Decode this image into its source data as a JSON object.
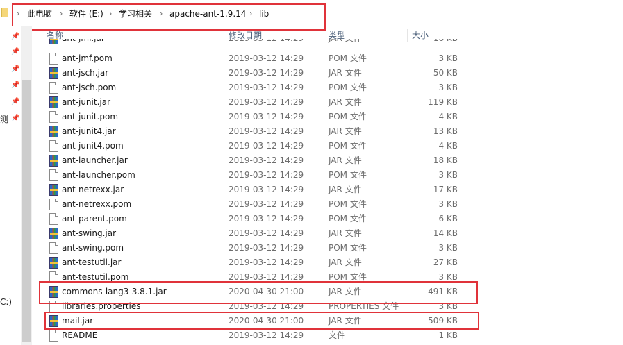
{
  "breadcrumb": [
    "此电脑",
    "软件 (E:)",
    "学习相关",
    "apache-ant-1.9.14",
    "lib"
  ],
  "sidebar": {
    "cut_label_1": "测",
    "cut_label_2": "C:)"
  },
  "columns": {
    "name": "名称",
    "date": "修改日期",
    "type": "类型",
    "size": "大小"
  },
  "partial_row": {
    "name": "ant-jmf.jar",
    "date": "2019-03-12 14:29",
    "type": "JAR 文件",
    "size": "16 KB",
    "icon": "jar-icon"
  },
  "files": [
    {
      "name": "ant-jmf.pom",
      "date": "2019-03-12 14:29",
      "type": "POM 文件",
      "size": "3 KB",
      "icon": "doc"
    },
    {
      "name": "ant-jsch.jar",
      "date": "2019-03-12 14:29",
      "type": "JAR 文件",
      "size": "50 KB",
      "icon": "jar"
    },
    {
      "name": "ant-jsch.pom",
      "date": "2019-03-12 14:29",
      "type": "POM 文件",
      "size": "3 KB",
      "icon": "doc"
    },
    {
      "name": "ant-junit.jar",
      "date": "2019-03-12 14:29",
      "type": "JAR 文件",
      "size": "119 KB",
      "icon": "jar"
    },
    {
      "name": "ant-junit.pom",
      "date": "2019-03-12 14:29",
      "type": "POM 文件",
      "size": "4 KB",
      "icon": "doc"
    },
    {
      "name": "ant-junit4.jar",
      "date": "2019-03-12 14:29",
      "type": "JAR 文件",
      "size": "13 KB",
      "icon": "jar"
    },
    {
      "name": "ant-junit4.pom",
      "date": "2019-03-12 14:29",
      "type": "POM 文件",
      "size": "4 KB",
      "icon": "doc"
    },
    {
      "name": "ant-launcher.jar",
      "date": "2019-03-12 14:29",
      "type": "JAR 文件",
      "size": "18 KB",
      "icon": "jar"
    },
    {
      "name": "ant-launcher.pom",
      "date": "2019-03-12 14:29",
      "type": "POM 文件",
      "size": "3 KB",
      "icon": "doc"
    },
    {
      "name": "ant-netrexx.jar",
      "date": "2019-03-12 14:29",
      "type": "JAR 文件",
      "size": "17 KB",
      "icon": "jar"
    },
    {
      "name": "ant-netrexx.pom",
      "date": "2019-03-12 14:29",
      "type": "POM 文件",
      "size": "3 KB",
      "icon": "doc"
    },
    {
      "name": "ant-parent.pom",
      "date": "2019-03-12 14:29",
      "type": "POM 文件",
      "size": "6 KB",
      "icon": "doc"
    },
    {
      "name": "ant-swing.jar",
      "date": "2019-03-12 14:29",
      "type": "JAR 文件",
      "size": "14 KB",
      "icon": "jar"
    },
    {
      "name": "ant-swing.pom",
      "date": "2019-03-12 14:29",
      "type": "POM 文件",
      "size": "3 KB",
      "icon": "doc"
    },
    {
      "name": "ant-testutil.jar",
      "date": "2019-03-12 14:29",
      "type": "JAR 文件",
      "size": "27 KB",
      "icon": "jar"
    },
    {
      "name": "ant-testutil.pom",
      "date": "2019-03-12 14:29",
      "type": "POM 文件",
      "size": "3 KB",
      "icon": "doc"
    },
    {
      "name": "commons-lang3-3.8.1.jar",
      "date": "2020-04-30 21:00",
      "type": "JAR 文件",
      "size": "491 KB",
      "icon": "jar"
    },
    {
      "name": "libraries.properties",
      "date": "2019-03-12 14:29",
      "type": "PROPERTIES 文件",
      "size": "3 KB",
      "icon": "doc"
    },
    {
      "name": "mail.jar",
      "date": "2020-04-30 21:00",
      "type": "JAR 文件",
      "size": "509 KB",
      "icon": "jar"
    },
    {
      "name": "README",
      "date": "2019-03-12 14:29",
      "type": "文件",
      "size": "1 KB",
      "icon": "doc"
    }
  ],
  "colors": {
    "highlight": "#e0333a",
    "header_text": "#4c607a"
  }
}
